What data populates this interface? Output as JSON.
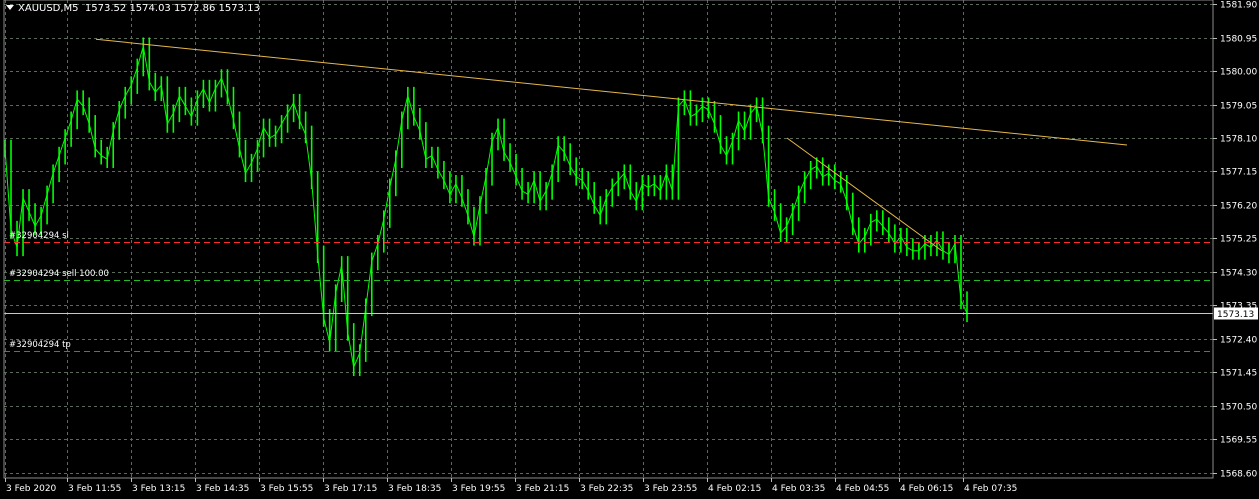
{
  "header": {
    "symbol": "XAUUSD,M5",
    "ohlc": "1573.52 1574.03 1572.86 1573.13"
  },
  "orders": [
    {
      "label": "#32904294 sl",
      "price": 1575.15,
      "color": "#ff2a2a"
    },
    {
      "label": "#32904294 sell 100.00",
      "price": 1574.08,
      "color": "#1fbf1f"
    },
    {
      "label": "#32904294 tp",
      "price": 1572.05,
      "color": "#ff2a2a"
    }
  ],
  "current_price": {
    "label": "1573.13",
    "value": 1573.13
  },
  "colors": {
    "background": "#000000",
    "candle": "#00ff00",
    "grid": "#5a6b5a",
    "trendline": "#e6b84a",
    "axis_text": "#ffffff"
  },
  "chart_data": {
    "type": "line",
    "title": "XAUUSD,M5",
    "ylim": [
      1568.2,
      1582.0
    ],
    "grid": true,
    "y_ticks": [
      "1581.90",
      "1580.95",
      "1580.00",
      "1579.05",
      "1578.10",
      "1577.15",
      "1576.20",
      "1575.25",
      "1574.30",
      "1573.35",
      "1572.40",
      "1571.45",
      "1570.50",
      "1569.55",
      "1568.60"
    ],
    "x_ticks": [
      "3 Feb 2020",
      "3 Feb 11:55",
      "3 Feb 13:15",
      "3 Feb 14:35",
      "3 Feb 15:55",
      "3 Feb 17:15",
      "3 Feb 18:35",
      "3 Feb 19:55",
      "3 Feb 21:15",
      "3 Feb 22:35",
      "3 Feb 23:55",
      "4 Feb 02:15",
      "4 Feb 03:35",
      "4 Feb 04:55",
      "4 Feb 06:15",
      "4 Feb 07:35"
    ],
    "series": [
      {
        "values": [
          1577.8,
          1575.5,
          1575.0,
          1576.4,
          1576.0,
          1575.6,
          1575.9,
          1576.5,
          1577.1,
          1577.6,
          1578.1,
          1578.6,
          1579.2,
          1579.0,
          1578.5,
          1577.8,
          1577.6,
          1577.5,
          1578.3,
          1578.9,
          1579.3,
          1579.6,
          1580.1,
          1580.7,
          1579.7,
          1579.4,
          1579.6,
          1578.5,
          1578.8,
          1579.3,
          1579.0,
          1578.7,
          1579.2,
          1579.5,
          1579.1,
          1579.5,
          1579.8,
          1579.3,
          1578.6,
          1577.8,
          1577.1,
          1577.4,
          1577.8,
          1578.4,
          1578.1,
          1578.2,
          1578.5,
          1578.8,
          1579.1,
          1578.6,
          1578.2,
          1576.9,
          1574.8,
          1573.0,
          1572.3,
          1573.7,
          1574.5,
          1572.6,
          1571.6,
          1572.0,
          1573.3,
          1574.6,
          1575.1,
          1575.8,
          1576.7,
          1577.5,
          1578.6,
          1579.3,
          1578.7,
          1578.3,
          1577.5,
          1577.6,
          1577.2,
          1576.9,
          1576.5,
          1576.8,
          1576.4,
          1575.9,
          1575.3,
          1576.2,
          1577.0,
          1578.0,
          1578.4,
          1577.7,
          1577.4,
          1577.0,
          1576.6,
          1576.5,
          1576.9,
          1576.3,
          1576.6,
          1577.1,
          1577.9,
          1577.7,
          1577.3,
          1577.0,
          1576.9,
          1576.6,
          1576.2,
          1575.9,
          1576.4,
          1576.7,
          1576.9,
          1577.1,
          1576.6,
          1576.3,
          1576.8,
          1576.7,
          1576.8,
          1576.6,
          1577.1,
          1576.6,
          1579.0,
          1579.2,
          1578.7,
          1578.8,
          1579.0,
          1578.9,
          1578.5,
          1577.9,
          1577.6,
          1578.0,
          1578.6,
          1578.3,
          1578.8,
          1579.0,
          1578.2,
          1576.4,
          1576.0,
          1575.4,
          1575.6,
          1576.0,
          1576.5,
          1576.9,
          1577.2,
          1577.3,
          1577.0,
          1577.1,
          1576.9,
          1576.8,
          1576.3,
          1575.6,
          1575.1,
          1575.3,
          1575.7,
          1575.8,
          1575.6,
          1575.4,
          1575.1,
          1575.3,
          1575.0,
          1574.9,
          1574.9,
          1575.1,
          1575.0,
          1575.2,
          1574.9,
          1574.8,
          1575.1,
          1573.5,
          1573.13
        ]
      }
    ],
    "trendlines": [
      {
        "from": [
          "3 Feb 11:55",
          1580.9
        ],
        "to": [
          "4 Feb 07:35",
          1577.9
        ]
      },
      {
        "from": [
          "4 Feb 03:35",
          1578.1
        ],
        "to": [
          "4 Feb 07:35",
          1574.9
        ]
      }
    ]
  }
}
